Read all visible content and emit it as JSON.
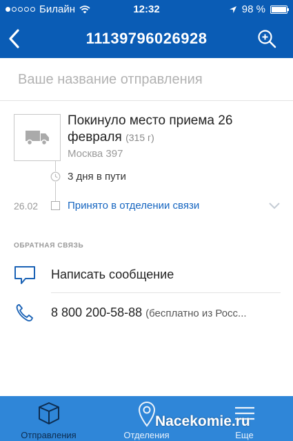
{
  "status_bar": {
    "carrier": "Билайн",
    "time": "12:32",
    "battery": "98 %",
    "battery_level": 0.98
  },
  "header": {
    "title": "11139796026928"
  },
  "name_field": {
    "placeholder": "Ваше название отправления",
    "value": ""
  },
  "tracking": {
    "current_status": "Покинуло место приема 26 февраля",
    "weight": "(315 г)",
    "location": "Москва 397",
    "transit": "3 дня в пути",
    "event_date": "26.02",
    "event_label": "Принято в отделении связи"
  },
  "feedback": {
    "section_title": "ОБРАТНАЯ СВЯЗЬ",
    "message_label": "Написать сообщение",
    "phone_number": "8 800 200-58-88",
    "phone_note": "(бесплатно из Росс..."
  },
  "tabs": [
    {
      "label": "Отправления",
      "icon": "box-icon",
      "active": true
    },
    {
      "label": "Отделения",
      "icon": "location-pin-icon",
      "active": false
    },
    {
      "label": "Еще",
      "icon": "menu-icon",
      "active": false
    }
  ],
  "watermark": "Nacekomie.ru",
  "colors": {
    "header": "#0a5cb5",
    "tabbar": "#2f86d8",
    "link": "#1565c0",
    "icon": "#1a62b5"
  }
}
